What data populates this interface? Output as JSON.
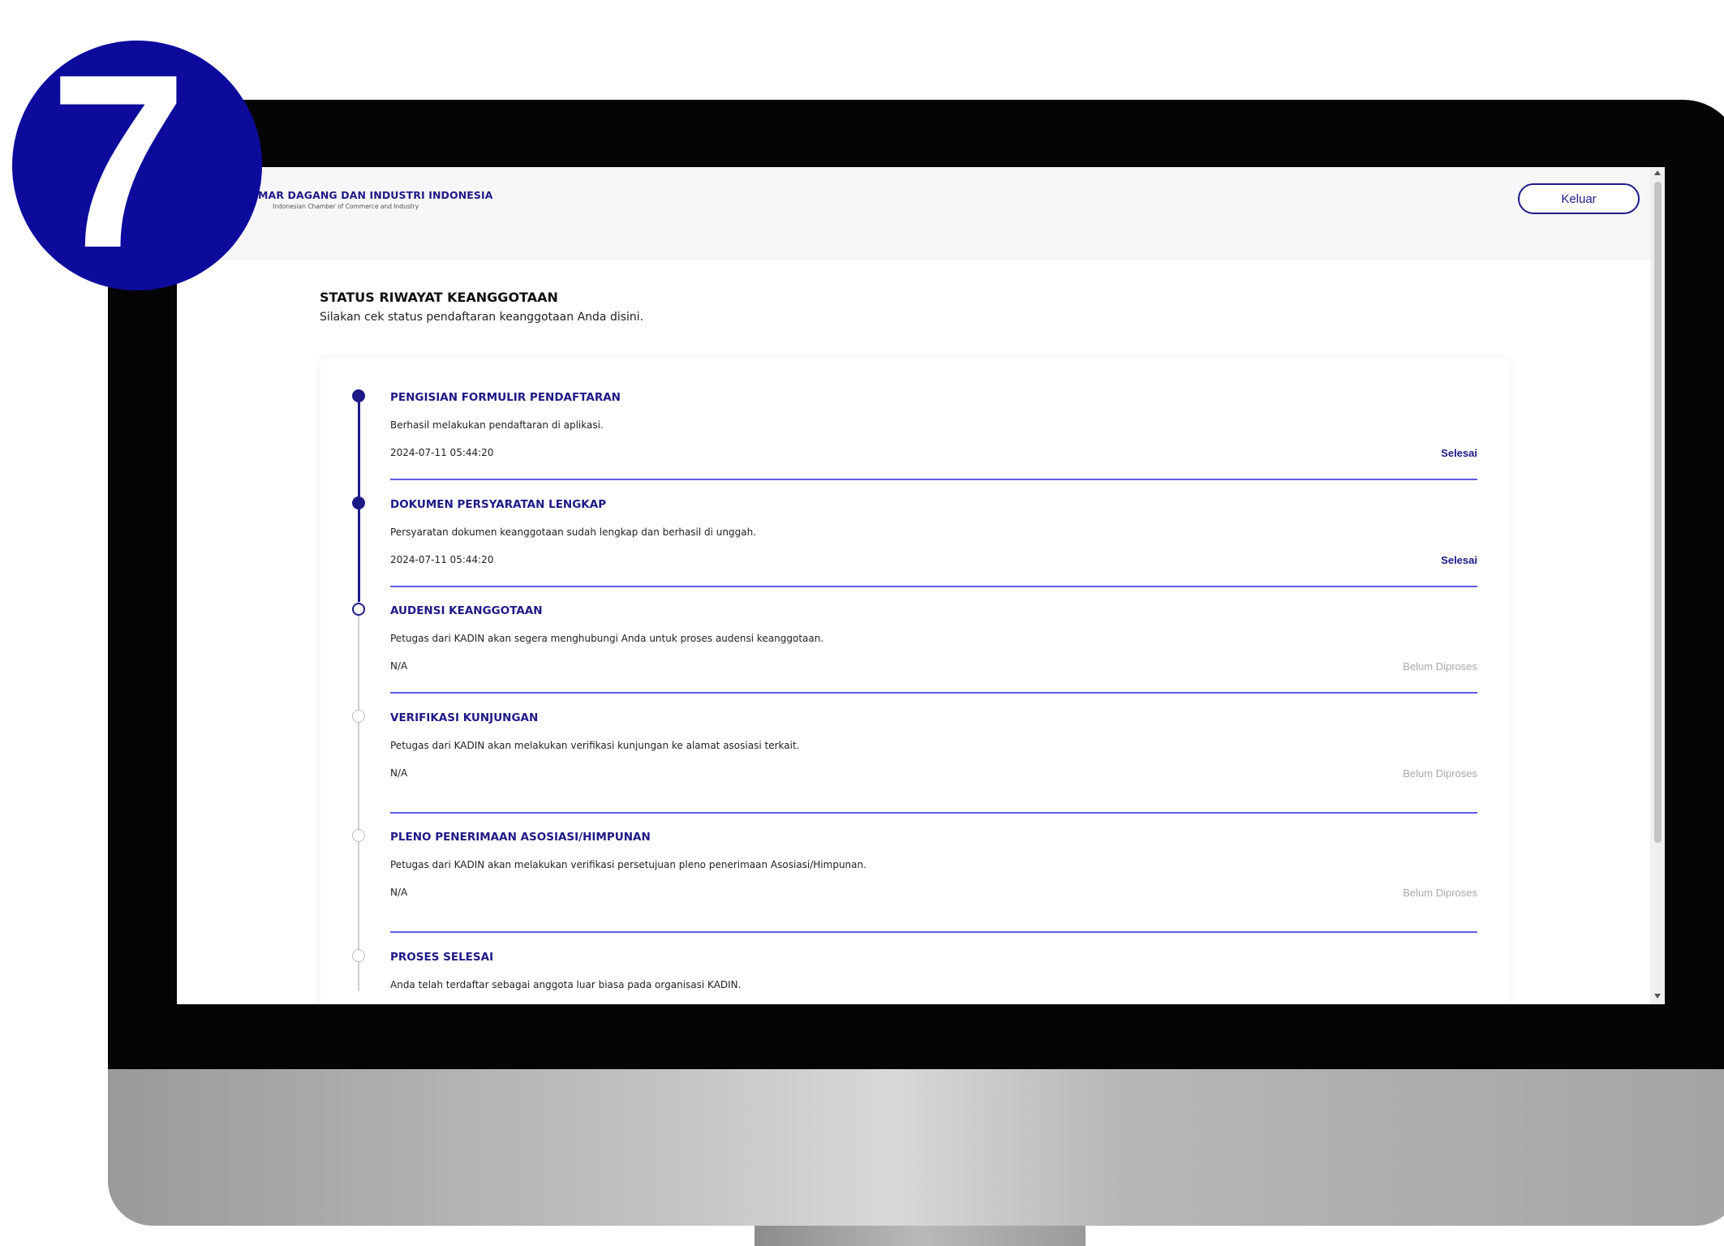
{
  "badge": {
    "number": "7"
  },
  "header": {
    "org_name": "MAR DAGANG DAN INDUSTRI INDONESIA",
    "org_subtitle": "Indonesian Chamber of Commerce and Industry",
    "logout_label": "Keluar"
  },
  "page": {
    "title": "STATUS RIWAYAT KEANGGOTAAN",
    "subtitle": "Silakan cek status pendaftaran keanggotaan Anda disini."
  },
  "steps": [
    {
      "title": "PENGISIAN FORMULIR PENDAFTARAN",
      "description": "Berhasil melakukan pendaftaran di aplikasi.",
      "date": "2024-07-11 05:44:20",
      "status": "Selesai",
      "state": "done"
    },
    {
      "title": "DOKUMEN PERSYARATAN LENGKAP",
      "description": "Persyaratan dokumen keanggotaan sudah lengkap dan berhasil di unggah.",
      "date": "2024-07-11 05:44:20",
      "status": "Selesai",
      "state": "done"
    },
    {
      "title": "AUDENSI KEANGGOTAAN",
      "description": "Petugas dari KADIN akan segera menghubungi Anda untuk proses audensi keanggotaan.",
      "date": "N/A",
      "status": "Belum Diproses",
      "state": "current"
    },
    {
      "title": "VERIFIKASI KUNJUNGAN",
      "description": "Petugas dari KADIN akan melakukan verifikasi kunjungan ke alamat asosiasi terkait.",
      "date": "N/A",
      "status": "Belum Diproses",
      "state": "todo"
    },
    {
      "title": "PLENO PENERIMAAN ASOSIASI/HIMPUNAN",
      "description": "Petugas dari KADIN akan melakukan verifikasi persetujuan pleno penerimaan Asosiasi/Himpunan.",
      "date": "N/A",
      "status": "Belum Diproses",
      "state": "todo"
    },
    {
      "title": "PROSES SELESAI",
      "description": "Anda telah terdaftar sebagai anggota luar biasa pada organisasi KADIN.",
      "state": "todo"
    }
  ],
  "colors": {
    "brand": "#1d1a87",
    "divider": "#5e5ce6",
    "badge": "#0d0b9c",
    "pending_text": "#a8a8a8"
  }
}
